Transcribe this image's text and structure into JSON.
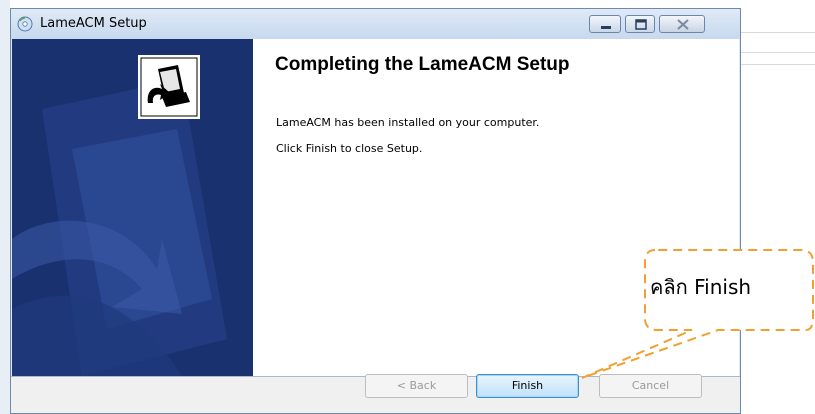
{
  "window": {
    "title": "LameACM Setup"
  },
  "content": {
    "heading": "Completing the LameACM Setup",
    "line1": "LameACM has been installed on your computer.",
    "line2": "Click Finish to close Setup."
  },
  "buttons": {
    "back": "< Back",
    "finish": "Finish",
    "cancel": "Cancel",
    "back_disabled": true,
    "cancel_disabled": true
  },
  "annotation": {
    "text": "คลิก Finish",
    "border_color": "#f0a030"
  },
  "colors": {
    "banner": "#1a3170",
    "titlebar": "#c7d9ee",
    "finish_highlight": "#3b8ed8"
  },
  "icons": {
    "app": "installer-disc-icon",
    "banner": "computer-install-icon"
  }
}
